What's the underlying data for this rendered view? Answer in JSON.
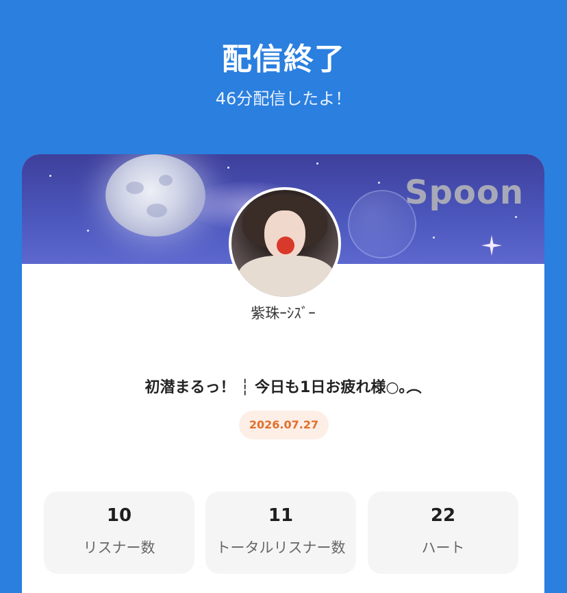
{
  "header": {
    "title": "配信終了",
    "subtitle": "46分配信したよ！"
  },
  "card": {
    "brand": "Spoon",
    "username": "紫珠ｰｼｽﾞｰ",
    "stream_title": "初潜まるっ！ ┆ 今日も1日お疲れ様○｡︵",
    "date": "2026.07.27"
  },
  "stats": [
    {
      "value": "10",
      "label": "リスナー数"
    },
    {
      "value": "11",
      "label": "トータルリスナー数"
    },
    {
      "value": "22",
      "label": "ハート"
    }
  ],
  "colors": {
    "background": "#2a7fdf",
    "date_text": "#e0702c",
    "date_badge": "#fdeee6"
  }
}
